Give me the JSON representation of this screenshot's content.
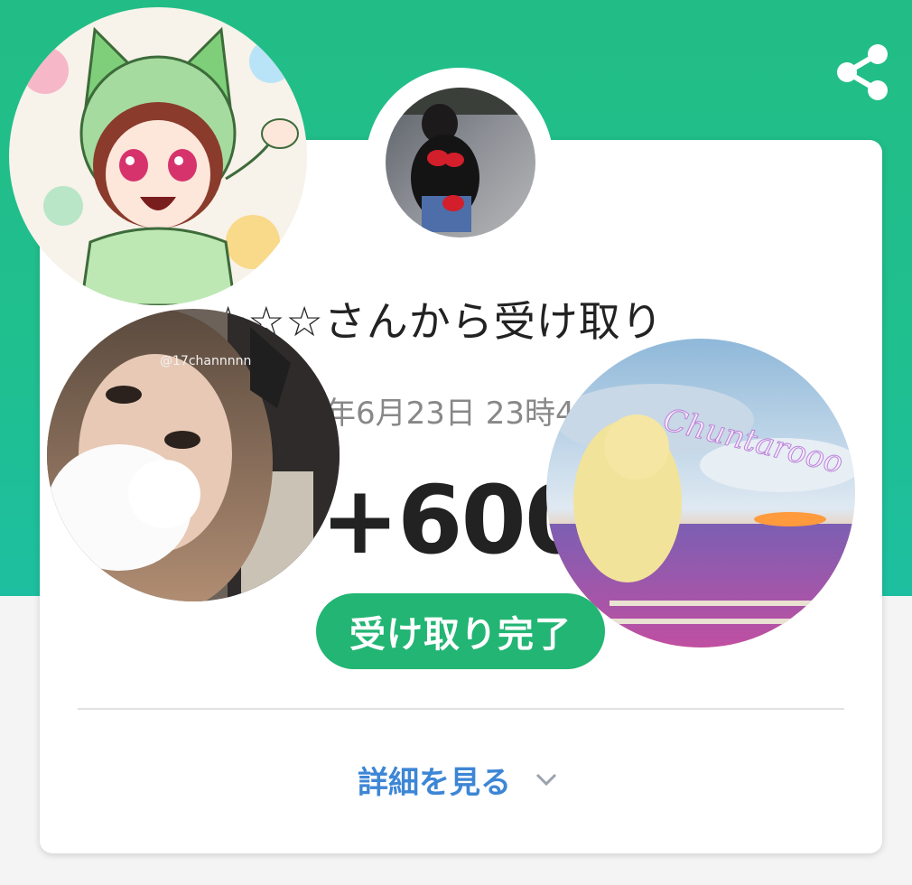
{
  "header": {
    "share_icon": "share-icon",
    "band_color_top": "#22bd86",
    "band_color_bottom": "#1dbfa0"
  },
  "card": {
    "title": "☆☆☆さんから受け取り",
    "date": "年6月23日 23時49",
    "amount": "+600",
    "status_label": "受け取り完了",
    "status_color": "#22b573",
    "details_label": "詳細を見る",
    "details_icon": "chevron-down-icon",
    "link_color": "#3d86d6"
  },
  "overlay_avatars": {
    "mid_left_watermark": "@17channnnn",
    "right_watermark": "Chuntarooo"
  }
}
